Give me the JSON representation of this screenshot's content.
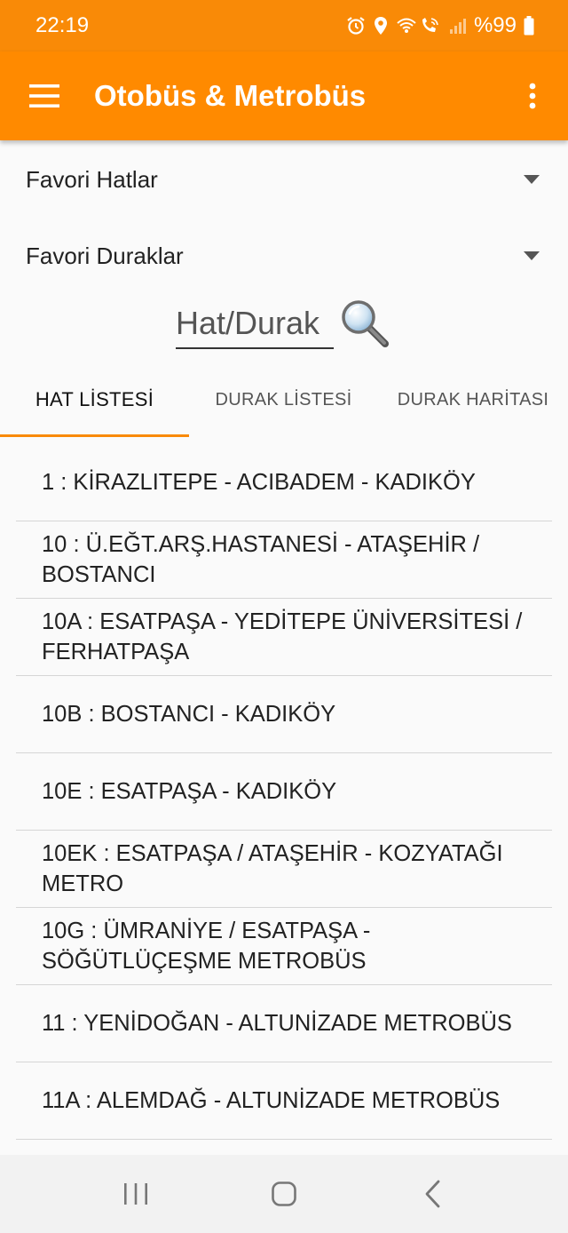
{
  "status_bar": {
    "time": "22:19",
    "battery": "%99",
    "icons": [
      "alarm-icon",
      "location-icon",
      "wifi-call-icon",
      "signal-icon",
      "battery-icon"
    ]
  },
  "app_bar": {
    "title": "Otobüs & Metrobüs",
    "menu_icon": "hamburger-menu-icon",
    "overflow_icon": "more-vertical-icon",
    "color": "#ff8a00"
  },
  "favorites": {
    "lines_label": "Favori Hatlar",
    "stops_label": "Favori Duraklar"
  },
  "search": {
    "placeholder": "Hat/Durak",
    "value": "",
    "icon": "magnifier-icon"
  },
  "tabs": [
    {
      "label": "HAT LİSTESİ",
      "active": true
    },
    {
      "label": "DURAK LİSTESİ",
      "active": false
    },
    {
      "label": "DURAK HARİTASI",
      "active": false
    }
  ],
  "lines": [
    "1 : KİRAZLITEPE - ACIBADEM - KADIKÖY",
    "10 : Ü.EĞT.ARŞ.HASTANESİ - ATAŞEHİR / BOSTANCI",
    "10A : ESATPAŞA - YEDİTEPE ÜNİVERSİTESİ / FERHATPAŞA",
    "10B : BOSTANCI - KADIKÖY",
    "10E : ESATPAŞA - KADIKÖY",
    "10EK : ESATPAŞA / ATAŞEHİR - KOZYATAĞI METRO",
    "10G : ÜMRANİYE / ESATPAŞA - SÖĞÜTLÜÇEŞME METROBÜS",
    "11 : YENİDOĞAN - ALTUNİZADE METROBÜS",
    "11A : ALEMDAĞ - ALTUNİZADE METROBÜS"
  ],
  "nav_bar": {
    "recents_icon": "recent-apps-icon",
    "home_icon": "home-icon",
    "back_icon": "back-icon"
  },
  "colors": {
    "accent": "#f98a07",
    "divider": "#d6d6d6"
  }
}
